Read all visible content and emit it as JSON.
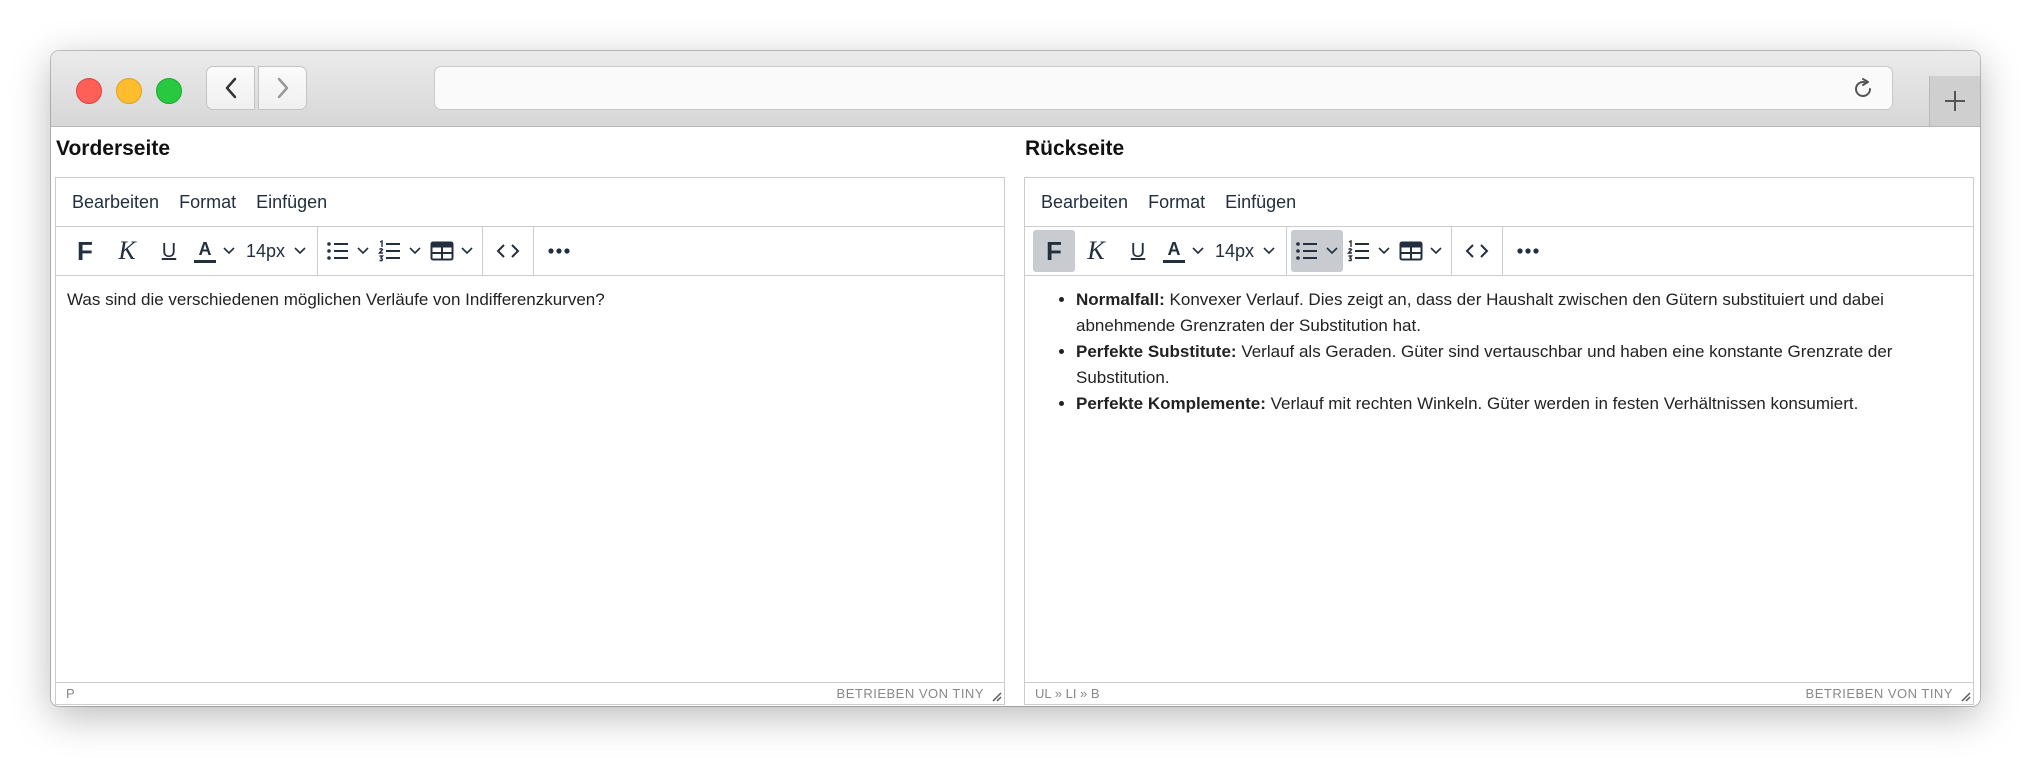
{
  "browser": {
    "traffic_lights": {
      "close": "#fe5f57",
      "minimize": "#febc2e",
      "maximize": "#28c840"
    },
    "url": ""
  },
  "editors": [
    {
      "title": "Vorderseite",
      "menu": [
        "Bearbeiten",
        "Format",
        "Einfügen"
      ],
      "font_size": "14px",
      "content_text": "Was sind die verschiedenen möglichen Verläufe von Indifferenzkurven?",
      "status_path": "P",
      "branding": "BETRIEBEN VON TINY"
    },
    {
      "title": "Rückseite",
      "menu": [
        "Bearbeiten",
        "Format",
        "Einfügen"
      ],
      "font_size": "14px",
      "list": [
        {
          "bold": "Normalfall:",
          "text": " Konvexer Verlauf. Dies zeigt an, dass der Haushalt zwischen den Gütern substituiert und dabei abnehmende Grenzraten der Substitution hat."
        },
        {
          "bold": "Perfekte Substitute:",
          "text": " Verlauf als Geraden. Güter sind vertauschbar und haben eine konstante Grenzrate der Substitution."
        },
        {
          "bold": "Perfekte Komplemente:",
          "text": " Verlauf mit rechten Winkeln. Güter werden in festen Verhältnissen konsumiert."
        }
      ],
      "status_path": "UL » LI » B",
      "branding": "BETRIEBEN VON TINY"
    }
  ]
}
